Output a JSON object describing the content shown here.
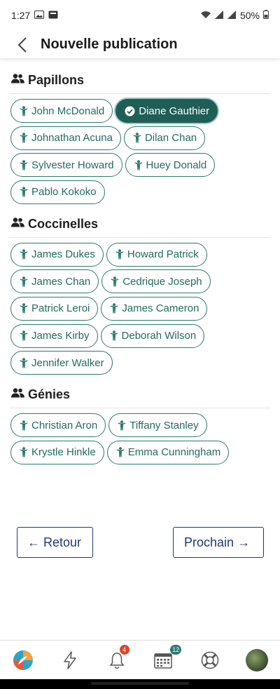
{
  "status_bar": {
    "time": "1:27",
    "battery": "50%"
  },
  "header": {
    "title": "Nouvelle publication"
  },
  "groups": [
    {
      "name": "Papillons",
      "members": [
        "John McDonald",
        "Diane Gauthier",
        "Johnathan Acuna",
        "Dilan Chan",
        "Sylvester Howard",
        "Huey Donald",
        "Pablo Kokoko"
      ],
      "selected": "Diane Gauthier"
    },
    {
      "name": "Coccinelles",
      "members": [
        "James Dukes",
        "Howard Patrick",
        "James Chan",
        "Cedrique Joseph",
        "Patrick Leroi",
        "James Cameron",
        "James Kirby",
        "Deborah Wilson",
        "Jennifer Walker"
      ]
    },
    {
      "name": "Génies",
      "members": [
        "Christian Aron",
        "Tiffany Stanley",
        "Krystle Hinkle",
        "Emma Cunningham"
      ]
    }
  ],
  "actions": {
    "back_label": "Retour",
    "next_label": "Prochain"
  },
  "bottom_nav": {
    "notifications_badge": "4",
    "calendar_badge": "12"
  },
  "colors": {
    "accent": "#2e7a70",
    "selected_bg": "#1f5e55",
    "button_text": "#1f3a6b"
  }
}
